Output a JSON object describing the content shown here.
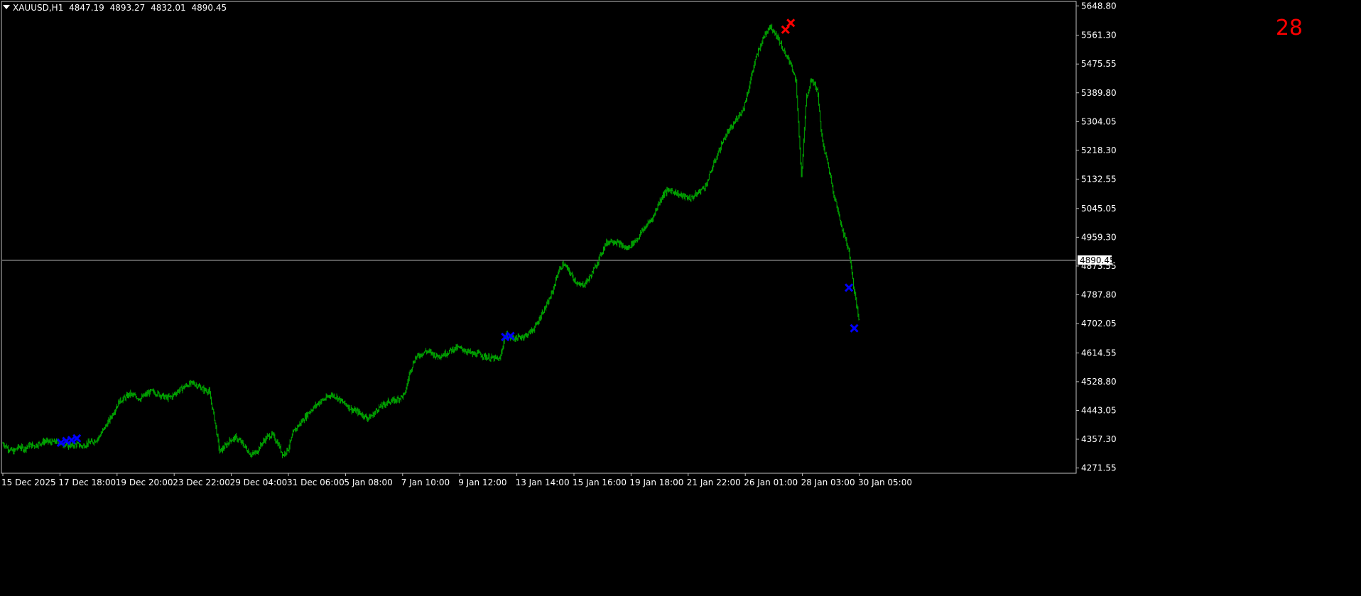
{
  "header": {
    "symbol": "XAUUSD,H1",
    "open": "4847.19",
    "high": "4893.27",
    "low": "4832.01",
    "close": "4890.45"
  },
  "counter": "28",
  "colors": {
    "background": "#000000",
    "bars": "#00a800",
    "axis": "#ffffff",
    "sell_marker": "#ff0000",
    "buy_marker": "#0000ff"
  },
  "chart_data": {
    "type": "line",
    "x_ticks": [
      "15 Dec 2025",
      "17 Dec 18:00",
      "19 Dec 20:00",
      "23 Dec 22:00",
      "29 Dec 04:00",
      "31 Dec 06:00",
      "5 Jan 08:00",
      "7 Jan 10:00",
      "9 Jan 12:00",
      "13 Jan 14:00",
      "15 Jan 16:00",
      "19 Jan 18:00",
      "21 Jan 22:00",
      "26 Jan 01:00",
      "28 Jan 03:00",
      "30 Jan 05:00"
    ],
    "y_ticks": [
      "5648.80",
      "5561.30",
      "5475.55",
      "5389.80",
      "5304.05",
      "5218.30",
      "5132.55",
      "5045.05",
      "4959.30",
      "4873.55",
      "4787.80",
      "4702.05",
      "4614.55",
      "4528.80",
      "4443.05",
      "4357.30",
      "4271.55"
    ],
    "ylim": [
      4258,
      5660
    ],
    "current_price": "4890.45",
    "series": [
      {
        "values": [
          4345,
          4330,
          4320,
          4335,
          4328,
          4340,
          4338,
          4345,
          4352,
          4348,
          4350,
          4345,
          4340,
          4338,
          4342,
          4336,
          4345,
          4350,
          4360,
          4385,
          4410,
          4440,
          4470,
          4480,
          4492,
          4485,
          4478,
          4490,
          4500,
          4495,
          4488,
          4480,
          4485,
          4500,
          4510,
          4520,
          4525,
          4515,
          4505,
          4500,
          4420,
          4320,
          4335,
          4355,
          4362,
          4350,
          4330,
          4310,
          4320,
          4345,
          4365,
          4370,
          4345,
          4310,
          4330,
          4380,
          4400,
          4420,
          4440,
          4455,
          4470,
          4478,
          4490,
          4485,
          4470,
          4460,
          4445,
          4440,
          4430,
          4420,
          4430,
          4450,
          4460,
          4470,
          4472,
          4480,
          4490,
          4560,
          4600,
          4610,
          4620,
          4615,
          4605,
          4608,
          4615,
          4625,
          4630,
          4625,
          4618,
          4610,
          4612,
          4605,
          4600,
          4598,
          4595,
          4670,
          4660,
          4658,
          4662,
          4668,
          4680,
          4700,
          4735,
          4760,
          4800,
          4855,
          4880,
          4860,
          4835,
          4815,
          4820,
          4840,
          4870,
          4905,
          4940,
          4950,
          4945,
          4935,
          4925,
          4940,
          4955,
          4980,
          5000,
          5020,
          5060,
          5090,
          5100,
          5095,
          5085,
          5080,
          5075,
          5085,
          5100,
          5115,
          5160,
          5200,
          5240,
          5270,
          5290,
          5320,
          5340,
          5400,
          5470,
          5520,
          5560,
          5590,
          5570,
          5540,
          5500,
          5480,
          5420,
          5140,
          5380,
          5430,
          5400,
          5240,
          5180,
          5100,
          5030,
          4970,
          4920,
          4800,
          4700
        ]
      }
    ],
    "markers": [
      {
        "type": "buy",
        "x_index": 11,
        "y": 4347
      },
      {
        "type": "buy",
        "x_index": 12,
        "y": 4352
      },
      {
        "type": "buy",
        "x_index": 13,
        "y": 4355
      },
      {
        "type": "buy",
        "x_index": 14,
        "y": 4360
      },
      {
        "type": "buy",
        "x_index": 95,
        "y": 4662
      },
      {
        "type": "buy",
        "x_index": 96,
        "y": 4665
      },
      {
        "type": "sell",
        "x_index": 148,
        "y": 5578
      },
      {
        "type": "sell",
        "x_index": 149,
        "y": 5598
      },
      {
        "type": "buy",
        "x_index": 160,
        "y": 4809
      },
      {
        "type": "buy",
        "x_index": 161,
        "y": 4688
      }
    ]
  }
}
